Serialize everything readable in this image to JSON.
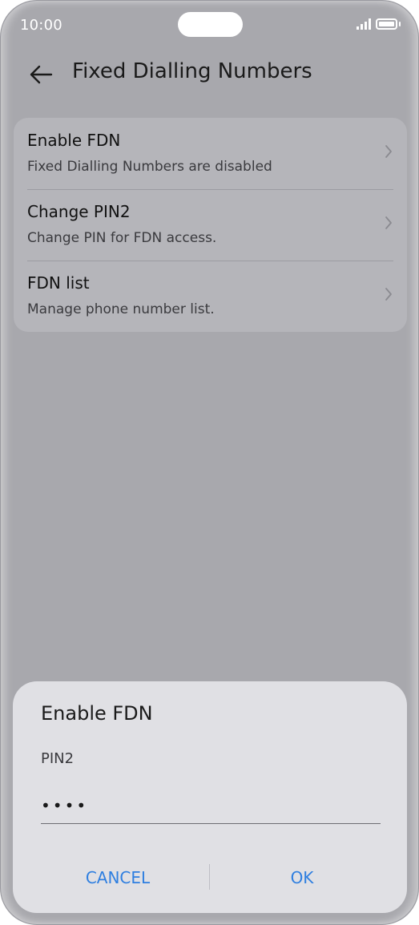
{
  "status_bar": {
    "time": "10:00"
  },
  "header": {
    "title": "Fixed Dialling Numbers",
    "back_icon": "arrow-left-icon"
  },
  "settings": {
    "items": [
      {
        "title": "Enable FDN",
        "subtitle": "Fixed Dialling Numbers are disabled"
      },
      {
        "title": "Change PIN2",
        "subtitle": "Change PIN for FDN access."
      },
      {
        "title": "FDN list",
        "subtitle": "Manage phone number list."
      }
    ]
  },
  "dialog": {
    "title": "Enable FDN",
    "field_label": "PIN2",
    "pin_value": "••••",
    "cancel_label": "CANCEL",
    "ok_label": "OK"
  },
  "colors": {
    "accent": "#2f7fe0",
    "scrim": "#a8a8ad",
    "dialog_bg": "#e0e0e4"
  }
}
